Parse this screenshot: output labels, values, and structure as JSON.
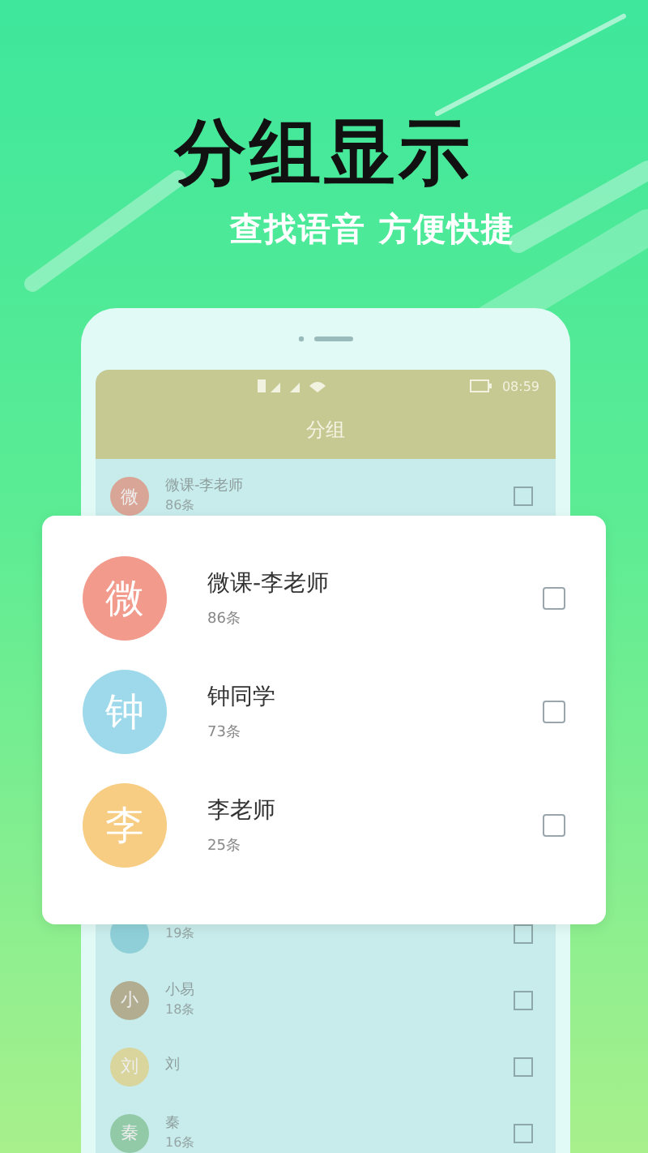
{
  "title": "分组显示",
  "subtitle": "查找语音 方便快捷",
  "phone": {
    "status_time": "08:59",
    "header_title": "分组",
    "rows_above": [
      {
        "avatar": "微",
        "name": "微课-李老师",
        "count": "86条",
        "color": "#d9a596",
        "checked": false
      }
    ],
    "rows_below": [
      {
        "count": "19条",
        "color": "#8fd0d8",
        "checked": false
      },
      {
        "avatar": "小",
        "name": "小易",
        "count": "18条",
        "color": "#b2ad90",
        "checked": false
      },
      {
        "avatar": "刘",
        "name": "刘",
        "color": "#d9d59c",
        "checked": false
      },
      {
        "avatar": "秦",
        "name": "秦",
        "count": "16条",
        "color": "#92caa8",
        "checked": false
      }
    ]
  },
  "card": {
    "rows": [
      {
        "avatar": "微",
        "name": "微课-李老师",
        "count": "86条",
        "color": "#f29a8c",
        "checked": false
      },
      {
        "avatar": "钟",
        "name": "钟同学",
        "count": "73条",
        "color": "#9dd9ea",
        "checked": false
      },
      {
        "avatar": "李",
        "name": "李老师",
        "count": "25条",
        "color": "#f6cd82",
        "checked": false
      }
    ]
  }
}
